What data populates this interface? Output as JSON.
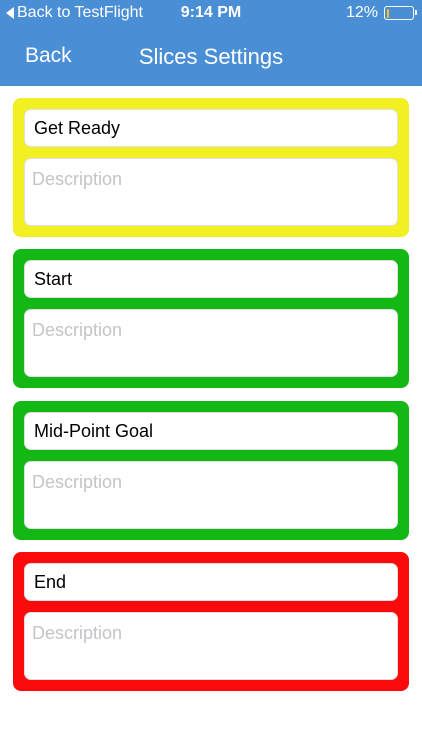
{
  "status_bar": {
    "back_label": "Back to TestFlight",
    "time": "9:14 PM",
    "battery_percent_text": "12%",
    "battery_level": 0.12,
    "battery_color": "#f5c518"
  },
  "nav": {
    "back_label": "Back",
    "title": "Slices Settings"
  },
  "colors": {
    "header": "#4a8ed6",
    "yellow": "#f2ef22",
    "green": "#14b814",
    "red": "#fa0a0a"
  },
  "slices": [
    {
      "name": "Get Ready",
      "description_placeholder": "Description",
      "color": "#f2ef22"
    },
    {
      "name": "Start",
      "description_placeholder": "Description",
      "color": "#14b814"
    },
    {
      "name": "Mid-Point Goal",
      "description_placeholder": "Description",
      "color": "#14b814"
    },
    {
      "name": "End",
      "description_placeholder": "Description",
      "color": "#fa0a0a"
    }
  ]
}
